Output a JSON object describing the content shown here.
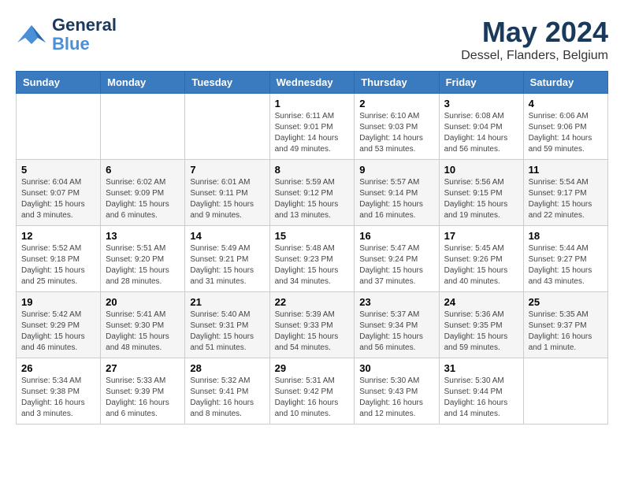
{
  "logo": {
    "line1": "General",
    "line2": "Blue"
  },
  "title": "May 2024",
  "subtitle": "Dessel, Flanders, Belgium",
  "weekdays": [
    "Sunday",
    "Monday",
    "Tuesday",
    "Wednesday",
    "Thursday",
    "Friday",
    "Saturday"
  ],
  "weeks": [
    [
      {
        "day": "",
        "info": ""
      },
      {
        "day": "",
        "info": ""
      },
      {
        "day": "",
        "info": ""
      },
      {
        "day": "1",
        "info": "Sunrise: 6:11 AM\nSunset: 9:01 PM\nDaylight: 14 hours\nand 49 minutes."
      },
      {
        "day": "2",
        "info": "Sunrise: 6:10 AM\nSunset: 9:03 PM\nDaylight: 14 hours\nand 53 minutes."
      },
      {
        "day": "3",
        "info": "Sunrise: 6:08 AM\nSunset: 9:04 PM\nDaylight: 14 hours\nand 56 minutes."
      },
      {
        "day": "4",
        "info": "Sunrise: 6:06 AM\nSunset: 9:06 PM\nDaylight: 14 hours\nand 59 minutes."
      }
    ],
    [
      {
        "day": "5",
        "info": "Sunrise: 6:04 AM\nSunset: 9:07 PM\nDaylight: 15 hours\nand 3 minutes."
      },
      {
        "day": "6",
        "info": "Sunrise: 6:02 AM\nSunset: 9:09 PM\nDaylight: 15 hours\nand 6 minutes."
      },
      {
        "day": "7",
        "info": "Sunrise: 6:01 AM\nSunset: 9:11 PM\nDaylight: 15 hours\nand 9 minutes."
      },
      {
        "day": "8",
        "info": "Sunrise: 5:59 AM\nSunset: 9:12 PM\nDaylight: 15 hours\nand 13 minutes."
      },
      {
        "day": "9",
        "info": "Sunrise: 5:57 AM\nSunset: 9:14 PM\nDaylight: 15 hours\nand 16 minutes."
      },
      {
        "day": "10",
        "info": "Sunrise: 5:56 AM\nSunset: 9:15 PM\nDaylight: 15 hours\nand 19 minutes."
      },
      {
        "day": "11",
        "info": "Sunrise: 5:54 AM\nSunset: 9:17 PM\nDaylight: 15 hours\nand 22 minutes."
      }
    ],
    [
      {
        "day": "12",
        "info": "Sunrise: 5:52 AM\nSunset: 9:18 PM\nDaylight: 15 hours\nand 25 minutes."
      },
      {
        "day": "13",
        "info": "Sunrise: 5:51 AM\nSunset: 9:20 PM\nDaylight: 15 hours\nand 28 minutes."
      },
      {
        "day": "14",
        "info": "Sunrise: 5:49 AM\nSunset: 9:21 PM\nDaylight: 15 hours\nand 31 minutes."
      },
      {
        "day": "15",
        "info": "Sunrise: 5:48 AM\nSunset: 9:23 PM\nDaylight: 15 hours\nand 34 minutes."
      },
      {
        "day": "16",
        "info": "Sunrise: 5:47 AM\nSunset: 9:24 PM\nDaylight: 15 hours\nand 37 minutes."
      },
      {
        "day": "17",
        "info": "Sunrise: 5:45 AM\nSunset: 9:26 PM\nDaylight: 15 hours\nand 40 minutes."
      },
      {
        "day": "18",
        "info": "Sunrise: 5:44 AM\nSunset: 9:27 PM\nDaylight: 15 hours\nand 43 minutes."
      }
    ],
    [
      {
        "day": "19",
        "info": "Sunrise: 5:42 AM\nSunset: 9:29 PM\nDaylight: 15 hours\nand 46 minutes."
      },
      {
        "day": "20",
        "info": "Sunrise: 5:41 AM\nSunset: 9:30 PM\nDaylight: 15 hours\nand 48 minutes."
      },
      {
        "day": "21",
        "info": "Sunrise: 5:40 AM\nSunset: 9:31 PM\nDaylight: 15 hours\nand 51 minutes."
      },
      {
        "day": "22",
        "info": "Sunrise: 5:39 AM\nSunset: 9:33 PM\nDaylight: 15 hours\nand 54 minutes."
      },
      {
        "day": "23",
        "info": "Sunrise: 5:37 AM\nSunset: 9:34 PM\nDaylight: 15 hours\nand 56 minutes."
      },
      {
        "day": "24",
        "info": "Sunrise: 5:36 AM\nSunset: 9:35 PM\nDaylight: 15 hours\nand 59 minutes."
      },
      {
        "day": "25",
        "info": "Sunrise: 5:35 AM\nSunset: 9:37 PM\nDaylight: 16 hours\nand 1 minute."
      }
    ],
    [
      {
        "day": "26",
        "info": "Sunrise: 5:34 AM\nSunset: 9:38 PM\nDaylight: 16 hours\nand 3 minutes."
      },
      {
        "day": "27",
        "info": "Sunrise: 5:33 AM\nSunset: 9:39 PM\nDaylight: 16 hours\nand 6 minutes."
      },
      {
        "day": "28",
        "info": "Sunrise: 5:32 AM\nSunset: 9:41 PM\nDaylight: 16 hours\nand 8 minutes."
      },
      {
        "day": "29",
        "info": "Sunrise: 5:31 AM\nSunset: 9:42 PM\nDaylight: 16 hours\nand 10 minutes."
      },
      {
        "day": "30",
        "info": "Sunrise: 5:30 AM\nSunset: 9:43 PM\nDaylight: 16 hours\nand 12 minutes."
      },
      {
        "day": "31",
        "info": "Sunrise: 5:30 AM\nSunset: 9:44 PM\nDaylight: 16 hours\nand 14 minutes."
      },
      {
        "day": "",
        "info": ""
      }
    ]
  ]
}
